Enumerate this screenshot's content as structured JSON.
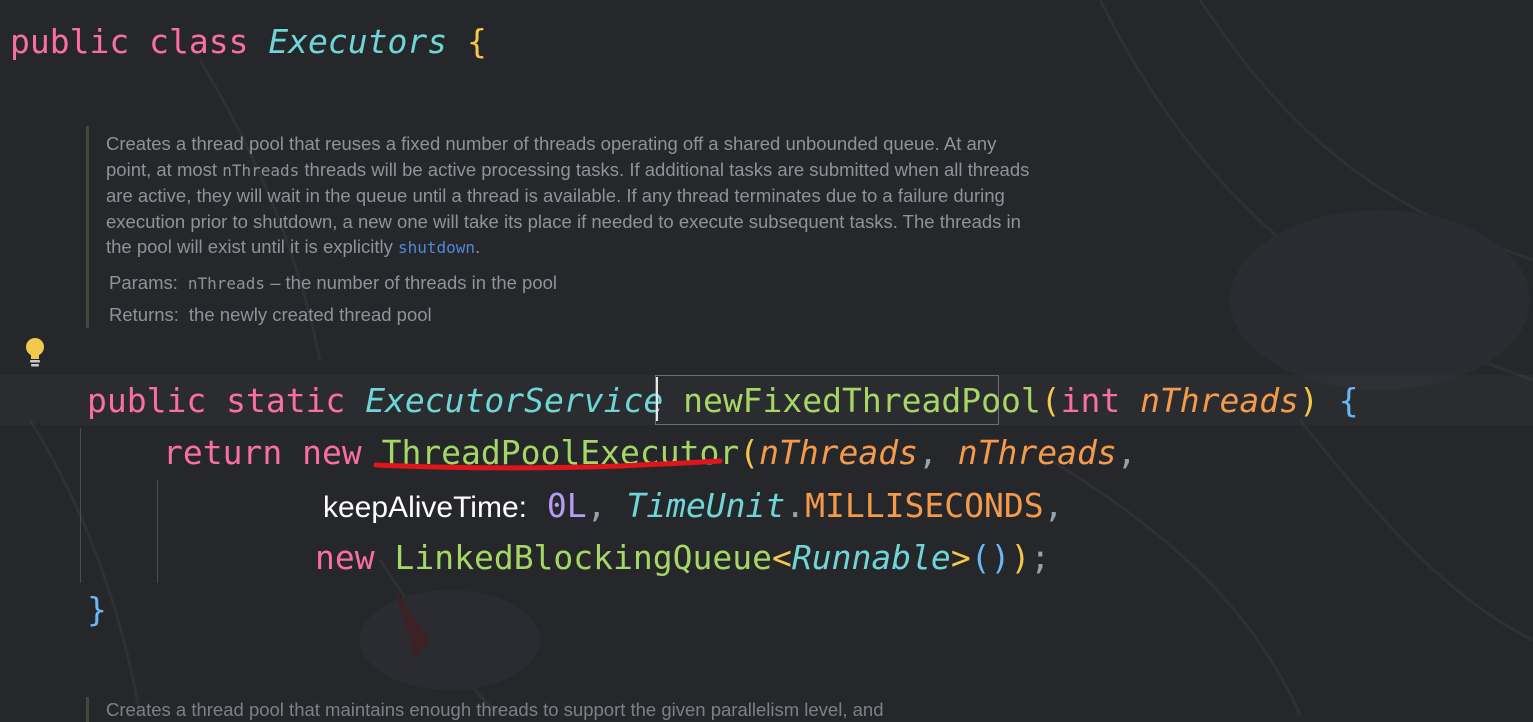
{
  "editor": {
    "class_decl": {
      "kw_public": "public",
      "kw_class": "class",
      "class_name": "Executors",
      "open_brace": "{"
    },
    "javadoc": {
      "text_1": "Creates a thread pool that reuses a fixed number of threads operating off a shared unbounded queue. At any point, at most ",
      "code_1": "nThreads",
      "text_2": " threads will be active processing tasks. If additional tasks are submitted when all threads are active, they will wait in the queue until a thread is available. If any thread terminates due to a failure during execution prior to shutdown, a new one will take its place if needed to execute subsequent tasks. The threads in the pool will exist until it is explicitly ",
      "link_1": "shutdown",
      "text_3": ".",
      "params_label": "Params:",
      "params_code": "nThreads",
      "params_text": " – the number of threads in the pool",
      "returns_label": "Returns:",
      "returns_text": "the newly created thread pool"
    },
    "method_decl": {
      "kw_public": "public",
      "kw_static": "static",
      "return_type": "ExecutorService",
      "method_name": "newFixedThreadPool",
      "open_paren": "(",
      "param_type": "int",
      "param_name": "nThreads",
      "close_paren": ")",
      "open_brace": "{"
    },
    "return_stmt": {
      "kw_return": "return",
      "kw_new": "new",
      "ctor": "ThreadPoolExecutor",
      "open_paren": "(",
      "arg1": "nThreads",
      "comma1": ",",
      "arg2": "nThreads",
      "comma2": ","
    },
    "line_keepalive": {
      "hint": "keepAliveTime:",
      "value": "0L",
      "comma1": ",",
      "unit_class": "TimeUnit",
      "dot": ".",
      "unit_const": "MILLISECONDS",
      "comma2": ","
    },
    "line_queue": {
      "kw_new": "new",
      "queue_class": "LinkedBlockingQueue",
      "lt": "<",
      "generic": "Runnable",
      "gt": ">",
      "inner_parens": "()",
      "close_paren": ")",
      "semicolon": ";"
    },
    "method_close": "}",
    "next_doc_text": "Creates a thread pool that maintains enough threads to support the given parallelism level, and"
  },
  "colors": {
    "background": "#26272b",
    "keyword": "#fa6ea3",
    "class": "#6fd6d6",
    "function": "#a6d766",
    "parameter": "#f59a4a",
    "number": "#b79cf5",
    "annotation_underline": "#e0141b"
  },
  "icons": {
    "intention_bulb": "lightbulb-icon"
  }
}
